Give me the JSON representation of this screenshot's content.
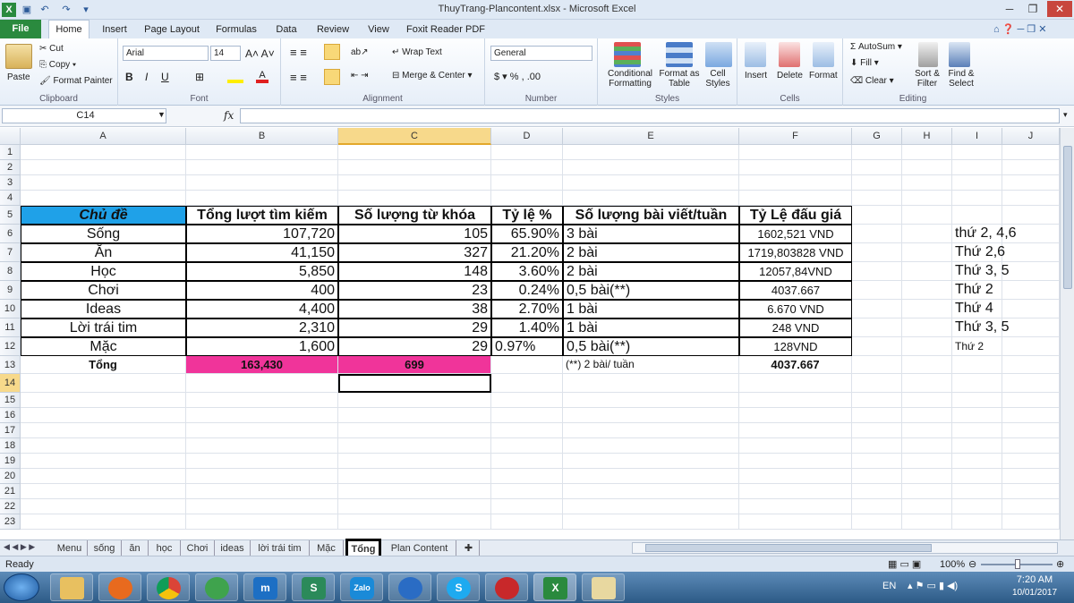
{
  "window": {
    "title": "ThuyTrang-Plancontent.xlsx - Microsoft Excel"
  },
  "ribbon_tabs": [
    "File",
    "Home",
    "Insert",
    "Page Layout",
    "Formulas",
    "Data",
    "Review",
    "View",
    "Foxit Reader PDF"
  ],
  "clipboard": {
    "paste": "Paste",
    "cut": "Cut",
    "copy": "Copy",
    "format_painter": "Format Painter",
    "label": "Clipboard"
  },
  "font": {
    "name": "Arial",
    "size": "14",
    "label": "Font"
  },
  "alignment": {
    "wrap": "Wrap Text",
    "merge": "Merge & Center",
    "label": "Alignment"
  },
  "number": {
    "format": "General",
    "label": "Number"
  },
  "styles": {
    "conditional": "Conditional Formatting",
    "format_table": "Format as Table",
    "cell_styles": "Cell Styles",
    "label": "Styles"
  },
  "cells_group": {
    "insert": "Insert",
    "delete": "Delete",
    "format": "Format",
    "label": "Cells"
  },
  "editing": {
    "autosum": "AutoSum",
    "fill": "Fill",
    "clear": "Clear",
    "sort": "Sort & Filter",
    "find": "Find & Select",
    "label": "Editing"
  },
  "formula_bar": {
    "name_box": "C14",
    "fx": "fx",
    "formula": ""
  },
  "columns": [
    "A",
    "B",
    "C",
    "D",
    "E",
    "F",
    "G",
    "H",
    "I",
    "J"
  ],
  "rows": [
    "1",
    "2",
    "3",
    "4",
    "5",
    "6",
    "7",
    "8",
    "9",
    "10",
    "11",
    "12",
    "13",
    "14",
    "15",
    "16",
    "17",
    "18",
    "19",
    "20",
    "21",
    "22",
    "23"
  ],
  "table": {
    "headers": [
      "Chủ đề",
      "Tổng lượt tìm kiếm",
      "Số lượng từ khóa",
      "Tỷ lệ %",
      "Số lượng bài viết/tuần",
      "Tỷ Lệ đấu giá"
    ],
    "rows": [
      [
        "Sống",
        "107,720",
        "105",
        "65.90%",
        "3 bài",
        "1602,521 VND",
        "thứ 2, 4,6"
      ],
      [
        "Ăn",
        "41,150",
        "327",
        "21.20%",
        "2 bài",
        "1719,803828 VND",
        "Thứ 2,6"
      ],
      [
        "Học",
        "5,850",
        "148",
        "3.60%",
        "2 bài",
        "12057,84VND",
        "Thứ 3, 5"
      ],
      [
        "Chơi",
        "400",
        "23",
        "0.24%",
        "0,5 bài(**)",
        "4037.667",
        "Thứ 2"
      ],
      [
        "Ideas",
        "4,400",
        "38",
        "2.70%",
        "1 bài",
        "6.670 VND",
        "Thứ 4"
      ],
      [
        "Lời trái tim",
        "2,310",
        "29",
        "1.40%",
        "1 bài",
        "248 VND",
        "Thứ 3, 5"
      ],
      [
        "Mặc",
        "1,600",
        "29",
        "0.97%",
        "0,5 bài(**)",
        "128VND",
        "Thứ 2"
      ]
    ],
    "total": {
      "label": "Tổng",
      "search": "163,430",
      "keywords": "699",
      "note": "(**) 2 bài/ tuần",
      "bid": "4037.667"
    }
  },
  "sheets": [
    "Menu",
    "sống",
    "ăn",
    "học",
    "Chơi",
    "ideas",
    "lời trái tim",
    "Mặc",
    "Tổng",
    "Plan Content"
  ],
  "active_sheet": "Tổng",
  "status": {
    "ready": "Ready",
    "zoom": "100%"
  },
  "taskbar": {
    "lang": "EN",
    "time": "7:20 AM",
    "date": "10/01/2017"
  },
  "colors": {
    "header_fill": "#1fa1e8",
    "total_fill": "#f0349a",
    "excel_green": "#2a8a3e"
  }
}
